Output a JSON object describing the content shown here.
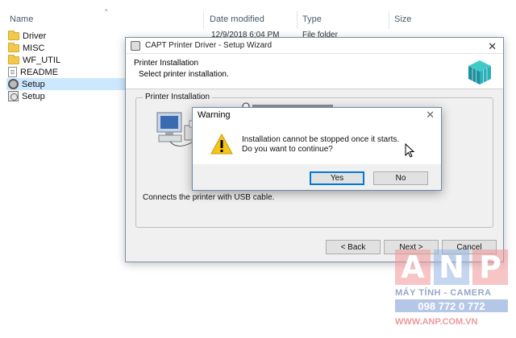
{
  "explorer": {
    "columns": {
      "name": "Name",
      "date": "Date modified",
      "type": "Type",
      "size": "Size"
    },
    "files": [
      {
        "name": "Driver",
        "icon": "folder-icon"
      },
      {
        "name": "MISC",
        "icon": "folder-icon"
      },
      {
        "name": "WF_UTIL",
        "icon": "folder-icon"
      },
      {
        "name": "README",
        "icon": "document-icon"
      },
      {
        "name": "Setup",
        "icon": "setup-gear-icon",
        "selected": true
      },
      {
        "name": "Setup",
        "icon": "setup-config-icon"
      }
    ],
    "peek_date": "12/9/2018 6:04 PM",
    "peek_type": "File folder"
  },
  "wizard": {
    "title": "CAPT Printer Driver - Setup Wizard",
    "header_title": "Printer Installation",
    "header_subtitle": "Select printer installation.",
    "group_label": "Printer Installation",
    "usb_text": "Connects the printer with USB cable.",
    "back_label": "< Back",
    "next_label": "Next >",
    "cancel_label": "Cancel"
  },
  "warning": {
    "title": "Warning",
    "line1": "Installation cannot be stopped once it starts.",
    "line2": "Do you want to continue?",
    "yes_label": "Yes",
    "no_label": "No"
  },
  "watermark": {
    "letters": [
      "A",
      "N",
      "P"
    ],
    "tagline": "MÁY TÍNH - CAMERA",
    "phone": "098 772 0 772",
    "url": "WWW.ANP.COM.VN"
  },
  "colors": {
    "accent": "#0078d7",
    "selection": "#cce8ff",
    "folder": "#f2c94c",
    "warning": "#f5c518"
  }
}
